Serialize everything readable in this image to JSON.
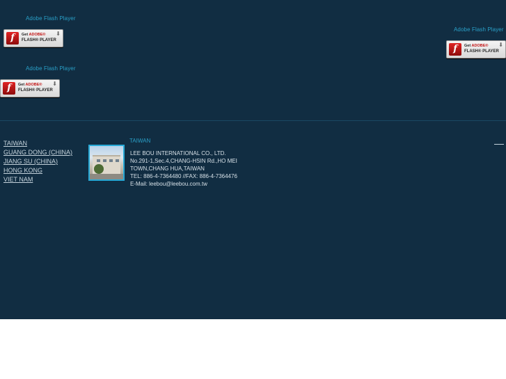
{
  "flash_blocks": [
    {
      "text": "Adobe Flash Player",
      "badge": {
        "line1_get": "Get",
        "line1_adobe": "ADOBE®",
        "line2": "FLASH® PLAYER"
      }
    },
    {
      "text": "Adobe Flash Player",
      "badge": {
        "line1_get": "Get",
        "line1_adobe": "ADOBE®",
        "line2": "FLASH® PLAYER"
      }
    },
    {
      "text": "Adobe Flash Player",
      "badge": {
        "line1_get": "Get",
        "line1_adobe": "ADOBE®",
        "line2": "FLASH® PLAYER"
      }
    }
  ],
  "nav": {
    "items": [
      "TAIWAN",
      "GUANG DONG (CHINA)",
      "JIANG SU (CHINA)",
      "HONG KONG",
      "VIET NAM"
    ]
  },
  "contact": {
    "region": "TAIWAN",
    "lines": [
      "LEE BOU INTERNATIONAL CO., LTD.",
      "No.291-1,Sec.4,CHANG-HSIN Rd.,HO MEI",
      "TOWN,CHANG HUA,TAIWAN",
      "TEL: 886-4-7364480 //FAX: 886-4-7364476",
      "E-Mail: leebou@leebou.com.tw"
    ]
  },
  "colors": {
    "background": "#112d42",
    "accent": "#2aa0c8",
    "link": "#c5d3dc"
  }
}
